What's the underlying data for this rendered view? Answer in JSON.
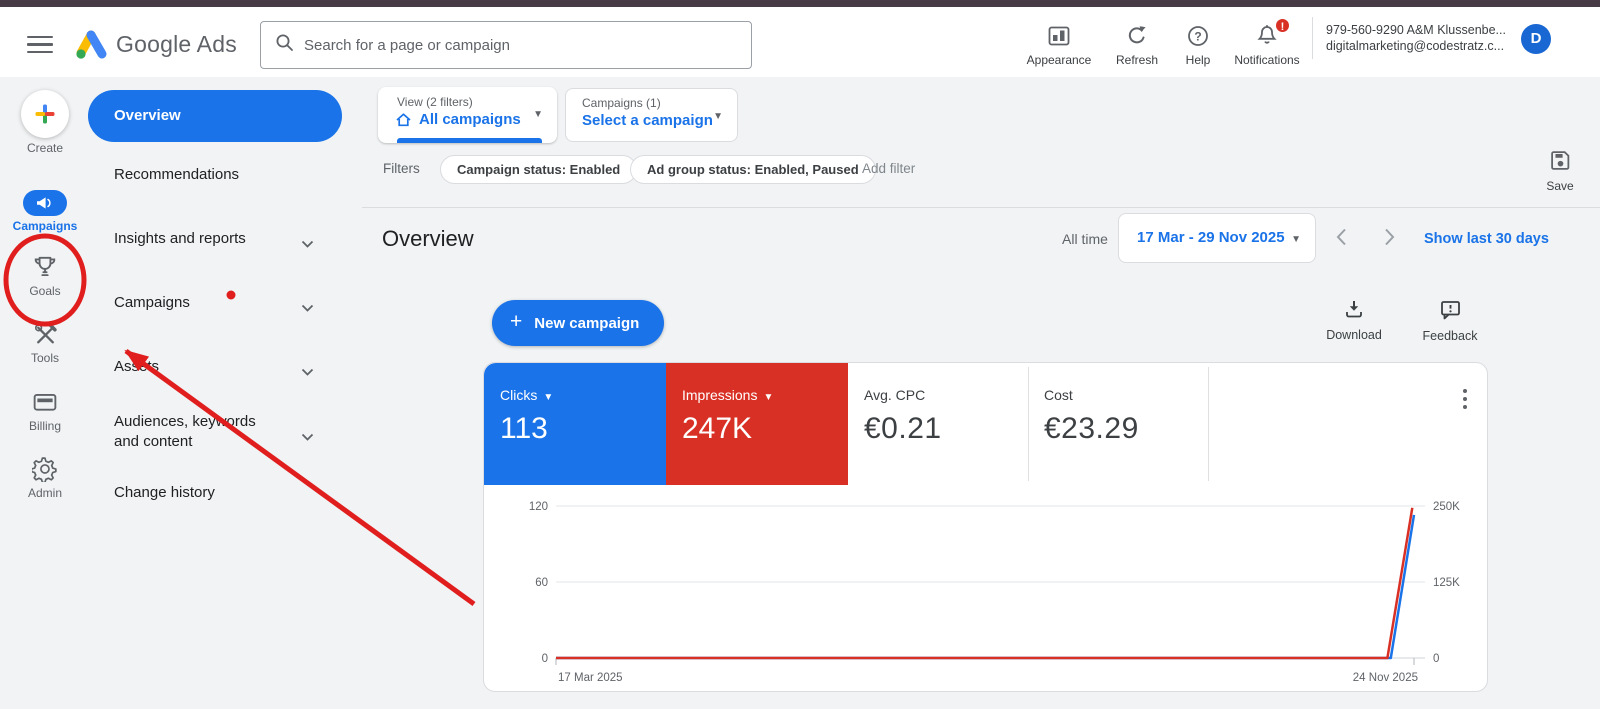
{
  "brand": {
    "name": "Google Ads"
  },
  "header": {
    "search_placeholder": "Search for a page or campaign",
    "actions": [
      {
        "label": "Appearance",
        "icon": "appearance-icon"
      },
      {
        "label": "Refresh",
        "icon": "refresh-icon"
      },
      {
        "label": "Help",
        "icon": "help-icon"
      },
      {
        "label": "Notifications",
        "icon": "notifications-bell-icon",
        "badge": "!"
      }
    ],
    "account": {
      "id_line": "979-560-9290 A&M Klussenbe...",
      "email_line": "digitalmarketing@codestratz.c...",
      "avatar_initial": "D"
    }
  },
  "left_rail": {
    "items": [
      {
        "label": "Create",
        "icon": "create-plus-icon"
      },
      {
        "label": "Campaigns",
        "icon": "megaphone-icon",
        "active": true
      },
      {
        "label": "Goals",
        "icon": "trophy-icon",
        "annotated": true
      },
      {
        "label": "Tools",
        "icon": "tools-icon"
      },
      {
        "label": "Billing",
        "icon": "billing-card-icon"
      },
      {
        "label": "Admin",
        "icon": "gear-icon"
      }
    ]
  },
  "side_nav": {
    "items": [
      {
        "label": "Overview",
        "active": true
      },
      {
        "label": "Recommendations"
      },
      {
        "label": "Insights and reports",
        "expandable": true
      },
      {
        "label": "Campaigns",
        "expandable": true
      },
      {
        "label": "Assets",
        "expandable": true
      },
      {
        "label": "Audiences, keywords and content",
        "expandable": true
      },
      {
        "label": "Change history"
      }
    ]
  },
  "toolbar": {
    "view_selector": {
      "label": "View (2 filters)",
      "value": "All campaigns"
    },
    "campaign_selector": {
      "label": "Campaigns (1)",
      "value": "Select a campaign"
    },
    "filters_label": "Filters",
    "filter_chips": [
      "Campaign status: Enabled",
      "Ad group status: Enabled, Paused"
    ],
    "add_filter_label": "Add filter",
    "save_label": "Save"
  },
  "overview": {
    "title": "Overview",
    "time_scope_label": "All time",
    "date_range": "17 Mar - 29 Nov 2025",
    "show_last_label": "Show last 30 days",
    "new_campaign_label": "New campaign",
    "download_label": "Download",
    "feedback_label": "Feedback"
  },
  "scorecards": [
    {
      "label": "Clicks",
      "value": "113",
      "bg": "#1a73e8",
      "selected": true
    },
    {
      "label": "Impressions",
      "value": "247K",
      "bg": "#d93025",
      "selected": true
    },
    {
      "label": "Avg. CPC",
      "value": "€0.21"
    },
    {
      "label": "Cost",
      "value": "€23.29"
    }
  ],
  "chart_data": {
    "type": "line",
    "title": "",
    "x_tick_labels": [
      "17 Mar 2025",
      "24 Nov 2025"
    ],
    "x_range": [
      "17 Mar 2025",
      "29 Nov 2025"
    ],
    "left_axis": {
      "label": "Clicks",
      "ticks": [
        0,
        60,
        120
      ],
      "max": 120
    },
    "right_axis": {
      "label": "Impressions",
      "ticks": [
        "0",
        "125K",
        "250K"
      ],
      "max": 250000
    },
    "grid": "horizontal",
    "legend": "none",
    "series": [
      {
        "name": "Clicks",
        "color": "#1a73e8",
        "axis": "left",
        "max": 120,
        "points": [
          {
            "x": 0,
            "v": 0
          },
          {
            "x": 0.973,
            "v": 0
          },
          {
            "x": 1.0,
            "v": 113
          }
        ]
      },
      {
        "name": "Impressions",
        "color": "#d93025",
        "axis": "right",
        "max": 250000,
        "points": [
          {
            "x": 0,
            "v": 0
          },
          {
            "x": 0.969,
            "v": 0
          },
          {
            "x": 0.998,
            "v": 247000
          }
        ]
      }
    ]
  },
  "annotation": {
    "color": "#e11e1e",
    "shapes": [
      "circle-around-goals",
      "red-dot",
      "arrow-pointing-to-goals"
    ]
  }
}
